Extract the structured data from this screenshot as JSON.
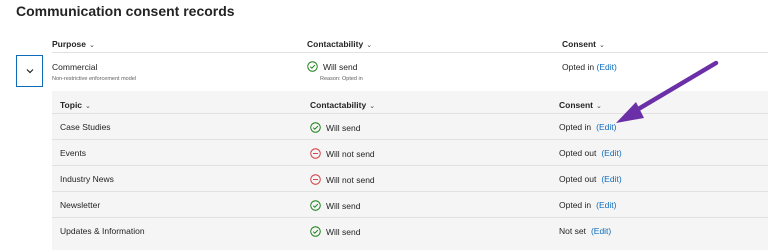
{
  "title": "Communication consent records",
  "header": {
    "purpose": "Purpose",
    "contactability": "Contactability",
    "consent": "Consent"
  },
  "purpose_row": {
    "name": "Commercial",
    "subtitle": "Non-restrictive enforcement model",
    "contactability": "Will send",
    "reason": "Reason: Opted in",
    "consent_prefix": "Opted in",
    "consent_edit": "(Edit)"
  },
  "sub_header": {
    "topic": "Topic",
    "contactability": "Contactability",
    "consent": "Consent"
  },
  "topics": [
    {
      "topic": "Case Studies",
      "contactability": "Will send",
      "status": "send",
      "consent": "Opted in",
      "edit": "(Edit)"
    },
    {
      "topic": "Events",
      "contactability": "Will not send",
      "status": "nosend",
      "consent": "Opted out",
      "edit": "(Edit)"
    },
    {
      "topic": "Industry News",
      "contactability": "Will not send",
      "status": "nosend",
      "consent": "Opted out",
      "edit": "(Edit)"
    },
    {
      "topic": "Newsletter",
      "contactability": "Will send",
      "status": "send",
      "consent": "Opted in",
      "edit": "(Edit)"
    },
    {
      "topic": "Updates & Information",
      "contactability": "Will send",
      "status": "send",
      "consent": "Not set",
      "edit": "(Edit)"
    }
  ],
  "colors": {
    "accent": "#0f6cbd",
    "success": "#107c10",
    "danger": "#d13438",
    "annotation_arrow": "#6b2fa8"
  },
  "icons": {
    "expand": "chevron-down-icon",
    "send": "check-circle-icon",
    "nosend": "minus-circle-icon",
    "sort": "chevron-down-icon"
  }
}
